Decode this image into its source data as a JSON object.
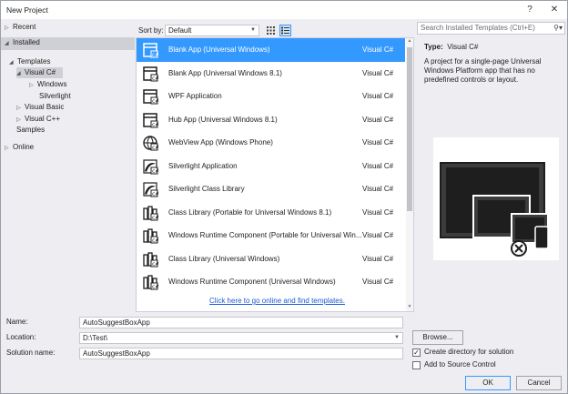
{
  "window": {
    "title": "New Project",
    "help": "?",
    "close": "✕"
  },
  "tree": {
    "recent": "Recent",
    "installed": "Installed",
    "templates": "Templates",
    "visual_csharp": "Visual C#",
    "windows": "Windows",
    "silverlight": "Silverlight",
    "visual_basic": "Visual Basic",
    "visual_cpp": "Visual C++",
    "samples": "Samples",
    "online": "Online"
  },
  "sort": {
    "label": "Sort by:",
    "value": "Default"
  },
  "templates": [
    {
      "name": "Blank App (Universal Windows)",
      "lang": "Visual C#",
      "icon": "blank-app-icon"
    },
    {
      "name": "Blank App (Universal Windows 8.1)",
      "lang": "Visual C#",
      "icon": "blank-app-81-icon"
    },
    {
      "name": "WPF Application",
      "lang": "Visual C#",
      "icon": "wpf-app-icon"
    },
    {
      "name": "Hub App (Universal Windows 8.1)",
      "lang": "Visual C#",
      "icon": "hub-app-icon"
    },
    {
      "name": "WebView App (Windows Phone)",
      "lang": "Visual C#",
      "icon": "webview-app-icon"
    },
    {
      "name": "Silverlight Application",
      "lang": "Visual C#",
      "icon": "silverlight-app-icon"
    },
    {
      "name": "Silverlight Class Library",
      "lang": "Visual C#",
      "icon": "silverlight-lib-icon"
    },
    {
      "name": "Class Library (Portable for Universal Windows 8.1)",
      "lang": "Visual C#",
      "icon": "class-lib-portable-icon"
    },
    {
      "name": "Windows Runtime Component (Portable for Universal Win...",
      "lang": "Visual C#",
      "icon": "winrt-portable-icon"
    },
    {
      "name": "Class Library (Universal Windows)",
      "lang": "Visual C#",
      "icon": "class-lib-uwp-icon"
    },
    {
      "name": "Windows Runtime Component (Universal Windows)",
      "lang": "Visual C#",
      "icon": "winrt-uwp-icon"
    }
  ],
  "online_link": "Click here to go online and find templates.",
  "search": {
    "placeholder": "Search Installed Templates (Ctrl+E)"
  },
  "details": {
    "type_label": "Type:",
    "type_value": "Visual C#",
    "description": "A project for a single-page Universal Windows Platform app that has no predefined controls or layout."
  },
  "form": {
    "name_label": "Name:",
    "name_value": "AutoSuggestBoxApp",
    "location_label": "Location:",
    "location_value": "D:\\Test\\",
    "solution_label": "Solution name:",
    "solution_value": "AutoSuggestBoxApp",
    "browse": "Browse...",
    "create_dir": "Create directory for solution",
    "create_dir_checked": true,
    "add_source": "Add to Source Control",
    "add_source_checked": false,
    "ok": "OK",
    "cancel": "Cancel"
  },
  "colors": {
    "accent": "#3399ff",
    "link": "#1a5cd6",
    "panel": "#eeeef2"
  }
}
